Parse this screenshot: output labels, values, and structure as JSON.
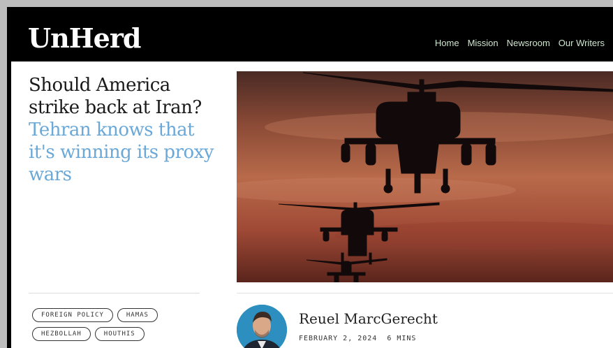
{
  "site": {
    "logo": "UnHerd"
  },
  "nav": {
    "items": [
      "Home",
      "Mission",
      "Newsroom",
      "Our Writers"
    ]
  },
  "article": {
    "headline_dark": "Should America strike back at Iran?",
    "headline_light": "Tehran knows that it's winning its proxy wars",
    "tags": [
      "FOREIGN POLICY",
      "HAMAS",
      "HEZBOLLAH",
      "HOUTHIS"
    ],
    "author": "Reuel MarcGerecht",
    "date": "FEBRUARY 2, 2024",
    "read_time": "6 MINS"
  },
  "colors": {
    "headline_accent": "#6aa8d8",
    "nav_text": "#cfe6cf"
  },
  "icons": {
    "hero_image": "helicopters-sunset-photo",
    "avatar": "author-photo"
  }
}
